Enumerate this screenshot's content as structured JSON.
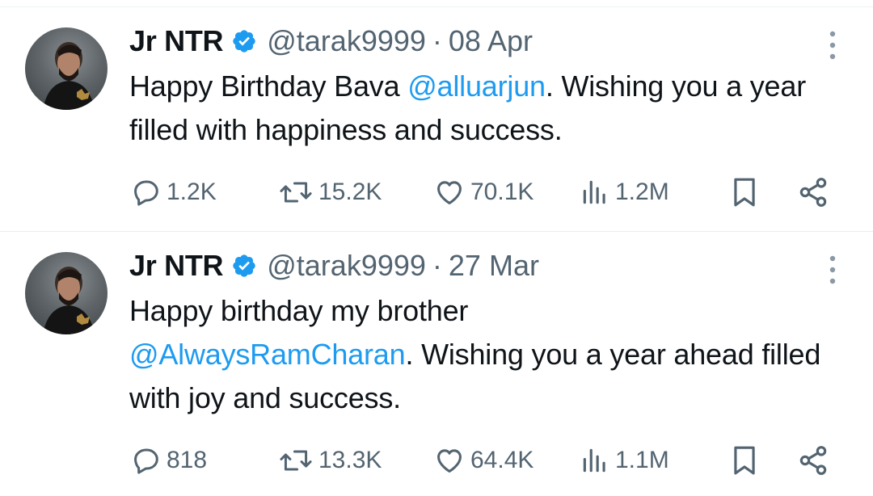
{
  "tweets": [
    {
      "display_name": "Jr NTR",
      "handle": "@tarak9999",
      "separator": "·",
      "date": "08 Apr",
      "text_parts": {
        "before": "Happy Birthday Bava ",
        "mention": "@alluarjun",
        "after": ". Wishing you a year filled with happiness and success."
      },
      "stats": {
        "replies": "1.2K",
        "reposts": "15.2K",
        "likes": "70.1K",
        "views": "1.2M"
      }
    },
    {
      "display_name": "Jr NTR",
      "handle": "@tarak9999",
      "separator": "·",
      "date": "27 Mar",
      "text_parts": {
        "before": "Happy birthday my brother",
        "mention": "@AlwaysRamCharan",
        "after": ". Wishing you a year ahead filled with joy and success."
      },
      "stats": {
        "replies": "818",
        "reposts": "13.3K",
        "likes": "64.4K",
        "views": "1.1M"
      }
    }
  ],
  "colors": {
    "text": "#0f1419",
    "secondary": "#536471",
    "accent": "#1d9bf0",
    "divider": "#e6ecef"
  },
  "icons": {
    "verified": "verified-badge-icon",
    "more": "more-vertical-icon",
    "reply": "reply-icon",
    "repost": "repost-icon",
    "like": "heart-icon",
    "views": "views-icon",
    "bookmark": "bookmark-icon",
    "share": "share-icon"
  }
}
